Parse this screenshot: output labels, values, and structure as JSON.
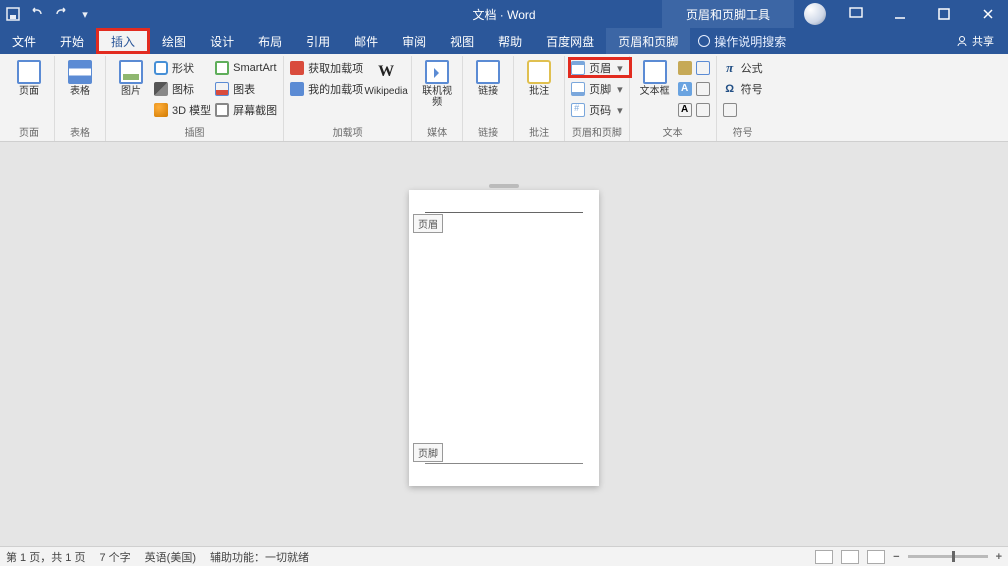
{
  "titlebar": {
    "app_title": "文档 · Word",
    "context_tab": "页眉和页脚工具"
  },
  "tabs": {
    "file": "文件",
    "home": "开始",
    "insert": "插入",
    "draw": "绘图",
    "design": "设计",
    "layout": "布局",
    "references": "引用",
    "mailings": "邮件",
    "review": "审阅",
    "view": "视图",
    "help": "帮助",
    "baidu": "百度网盘",
    "headerfooter": "页眉和页脚",
    "tell_me": "操作说明搜索",
    "share": "共享"
  },
  "ribbon": {
    "pages": {
      "cover_label": "页面",
      "group": "页面"
    },
    "tables": {
      "label": "表格",
      "group": "表格"
    },
    "illus": {
      "pic": "图片",
      "shape": "形状",
      "icons": "图标",
      "model3d": "3D 模型",
      "smartart": "SmartArt",
      "chart": "图表",
      "screenshot": "屏幕截图",
      "group": "插图"
    },
    "addins": {
      "get": "获取加载项",
      "my": "我的加载项",
      "wiki": "Wikipedia",
      "group": "加载项"
    },
    "media": {
      "video": "联机视频",
      "group": "媒体"
    },
    "links": {
      "link": "链接",
      "group": "链接"
    },
    "comments": {
      "label": "批注",
      "group": "批注"
    },
    "hf": {
      "header": "页眉",
      "footer": "页脚",
      "pageno": "页码",
      "group": "页眉和页脚"
    },
    "text": {
      "textbox": "文本框",
      "group": "文本"
    },
    "symbols": {
      "equation": "公式",
      "symbol": "符号",
      "group": "符号"
    }
  },
  "document": {
    "header_tag": "页眉",
    "footer_tag": "页脚"
  },
  "status": {
    "page": "第 1 页，共 1 页",
    "words": "7 个字",
    "lang": "英语(美国)",
    "accessibility": "辅助功能：一切就绪"
  }
}
